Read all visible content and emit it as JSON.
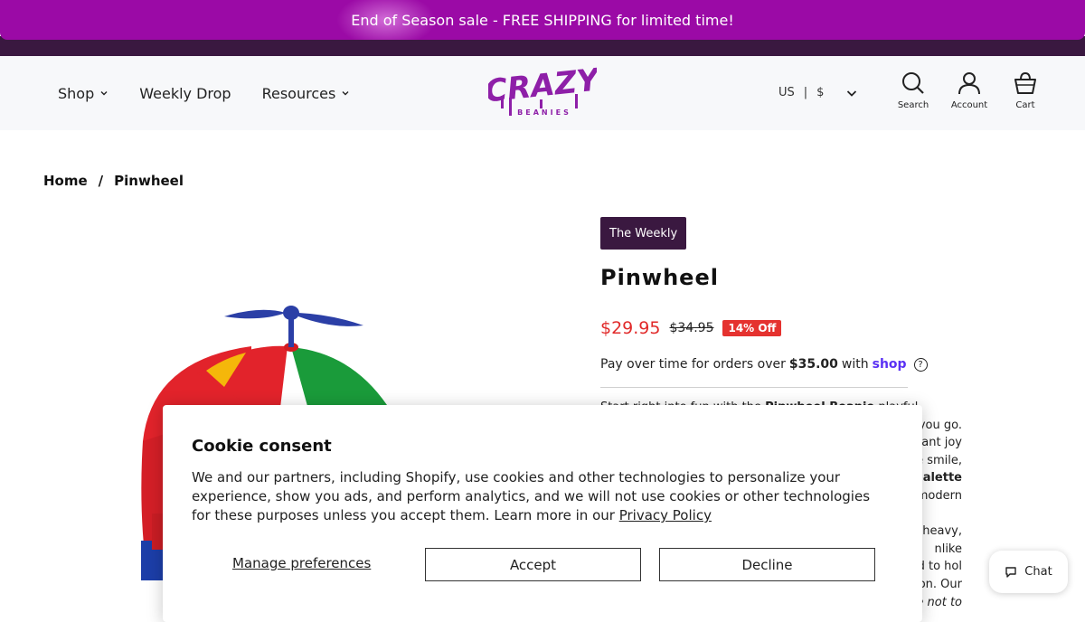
{
  "announcement": {
    "text": "End of Season sale - FREE SHIPPING for limited time!"
  },
  "header": {
    "nav": [
      {
        "label": "Shop",
        "has_dropdown": true
      },
      {
        "label": "Weekly Drop",
        "has_dropdown": false
      },
      {
        "label": "Resources",
        "has_dropdown": true
      }
    ],
    "logo": {
      "main": "CRAZY",
      "sub": "BEANIES",
      "color": "#8e1fa8"
    },
    "locale": {
      "country": "US",
      "separator": "|",
      "currency": "$"
    },
    "icons": [
      {
        "name": "search-icon",
        "label": "Search"
      },
      {
        "name": "account-icon",
        "label": "Account"
      },
      {
        "name": "cart-icon",
        "label": "Cart"
      }
    ]
  },
  "breadcrumb": {
    "home": "Home",
    "separator": "/",
    "current": "Pinwheel"
  },
  "product": {
    "badge": "The Weekly",
    "title": "Pinwheel",
    "price": "$29.95",
    "compare_price": "$34.95",
    "discount": "14% Off",
    "pay_over": {
      "prefix": "Pay over time for orders over",
      "amount": "$35.00",
      "middle": "with",
      "brand": "shop",
      "help": "?"
    },
    "description_fragments": [
      [
        "St",
        "art",
        "rig",
        "ht",
        "into",
        "fun",
        "with",
        "the",
        "Pinwheel Beanie",
        "playful,"
      ],
      [
        "ere you go."
      ],
      [
        "instant joy"
      ],
      [
        "eople smile,"
      ],
      [
        "or palette"
      ],
      [
        "ts-modern"
      ],
      [
        "eeling heavy,"
      ],
      [
        "nlike"
      ],
      [
        "afted to hol"
      ],
      [
        "ason. Our"
      ],
      [
        "ble not to"
      ]
    ]
  },
  "cookie": {
    "title": "Cookie consent",
    "body": "We and our partners, including Shopify, use cookies and other technologies to personalize your experience, show you ads, and perform analytics, and we will not use cookies or other technologies for these purposes unless you accept them. Learn more in our",
    "policy_link": "Privacy Policy",
    "manage": "Manage preferences",
    "accept": "Accept",
    "decline": "Decline"
  },
  "chat": {
    "label": "Chat"
  },
  "colors": {
    "announce_bg": "#9b0aa6",
    "dark_bar": "#3a1840",
    "price_red": "#e12b2b",
    "shop_purple": "#5a31f4"
  }
}
